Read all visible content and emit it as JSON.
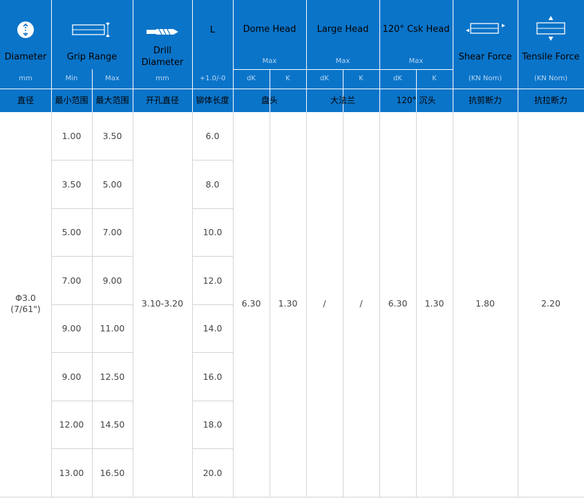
{
  "header": {
    "diameter": {
      "title": "Diameter",
      "unit": "mm",
      "cn": "直径"
    },
    "grip_range": {
      "title": "Grip Range",
      "sub_min": "Min",
      "sub_max": "Max",
      "cn_min": "最小范围",
      "cn_max": "最大范围"
    },
    "drill": {
      "title": "Drill Diameter",
      "unit": "mm",
      "cn": "开孔直径"
    },
    "length": {
      "title": "L",
      "tolerance": "+1.0/-0",
      "cn": "铆体长度"
    },
    "dome_head": {
      "title": "Dome Head",
      "max": "Max",
      "dk": "dK",
      "k": "K",
      "cn": "盘头"
    },
    "large_head": {
      "title": "Large Head",
      "max": "Max",
      "dk": "dK",
      "k": "K",
      "cn": "大法兰"
    },
    "csk_head": {
      "title": "120° Csk Head",
      "max": "Max",
      "dk": "dK",
      "k": "K",
      "cn": "120° 沉头"
    },
    "shear": {
      "title": "Shear Force",
      "unit": "(KN Nom)",
      "cn": "抗剪断力"
    },
    "tensile": {
      "title": "Tensile Force",
      "unit": "(KN Nom)",
      "cn": "抗拉断力"
    }
  },
  "body": {
    "diameter_line1": "Φ3.0",
    "diameter_line2": "(7/61\")",
    "drill": "3.10-3.20",
    "dome_dk": "6.30",
    "dome_k": "1.30",
    "large_dk": "/",
    "large_k": "/",
    "csk_dk": "6.30",
    "csk_k": "1.30",
    "shear": "1.80",
    "tensile": "2.20",
    "rows": [
      {
        "min": "1.00",
        "max": "3.50",
        "l": "6.0"
      },
      {
        "min": "3.50",
        "max": "5.00",
        "l": "8.0"
      },
      {
        "min": "5.00",
        "max": "7.00",
        "l": "10.0"
      },
      {
        "min": "7.00",
        "max": "9.00",
        "l": "12.0"
      },
      {
        "min": "9.00",
        "max": "11.00",
        "l": "14.0"
      },
      {
        "min": "9.00",
        "max": "12.50",
        "l": "16.0"
      },
      {
        "min": "12.00",
        "max": "14.50",
        "l": "18.0"
      },
      {
        "min": "13.00",
        "max": "16.50",
        "l": "20.0"
      }
    ]
  },
  "colors": {
    "header_bg": "#0a74c9",
    "text": "#444444",
    "grid": "#d4d4d4",
    "sub_text": "#b9d7f1"
  },
  "icons": [
    "diameter-icon",
    "grip-range-icon",
    "drill-icon",
    "shear-force-icon",
    "tensile-force-icon"
  ]
}
